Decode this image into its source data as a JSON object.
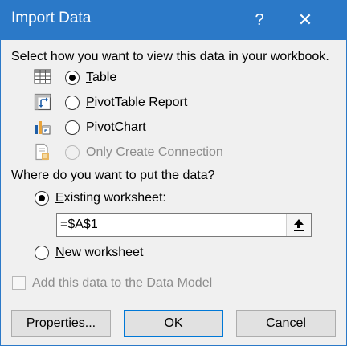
{
  "dialog": {
    "title": "Import Data",
    "help_glyph": "?",
    "close_glyph": "✕",
    "view_prompt": "Select how you want to view this data in your workbook.",
    "view_options": [
      {
        "key": "T",
        "rest": "able",
        "icon": "table-icon",
        "state": "checked"
      },
      {
        "key": "P",
        "rest": "ivotTable Report",
        "icon": "pivottable-icon",
        "state": "unchecked"
      },
      {
        "prefix": "Pivot",
        "key": "C",
        "rest": "hart",
        "icon": "pivotchart-icon",
        "state": "unchecked"
      },
      {
        "label": "Only Create Connection",
        "icon": "connection-icon",
        "state": "disabled"
      }
    ],
    "location_prompt": "Where do you want to put the data?",
    "existing": {
      "key": "E",
      "rest": "xisting worksheet:",
      "state": "checked"
    },
    "cell_reference": "=$A$1",
    "new_ws": {
      "key": "N",
      "rest": "ew worksheet",
      "state": "unchecked"
    },
    "data_model": {
      "label": "Add this data to the Data Model",
      "state": "disabled"
    },
    "buttons": {
      "properties": {
        "key": "r",
        "prefix": "P",
        "rest": "operties..."
      },
      "ok": "OK",
      "cancel": "Cancel"
    },
    "colors": {
      "titlebar": "#2b79c8",
      "accent": "#0078d7",
      "background": "#f0f0f0"
    }
  }
}
